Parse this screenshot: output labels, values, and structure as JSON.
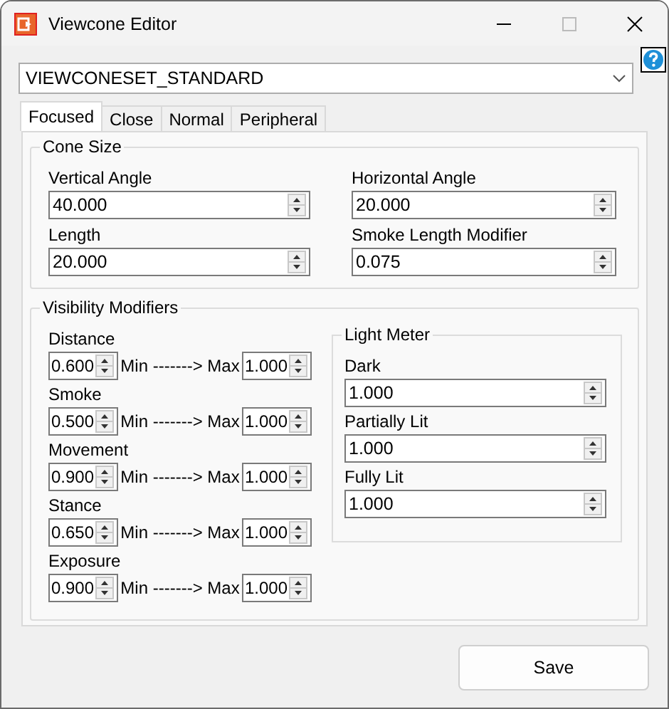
{
  "window": {
    "title": "Viewcone Editor"
  },
  "preset": {
    "value": "VIEWCONESET_STANDARD"
  },
  "tabs": [
    {
      "label": "Focused",
      "selected": true
    },
    {
      "label": "Close",
      "selected": false
    },
    {
      "label": "Normal",
      "selected": false
    },
    {
      "label": "Peripheral",
      "selected": false
    }
  ],
  "cone_size": {
    "title": "Cone Size",
    "fields": [
      {
        "label": "Vertical Angle",
        "value": "40.000"
      },
      {
        "label": "Horizontal Angle",
        "value": "20.000"
      },
      {
        "label": "Length",
        "value": "20.000"
      },
      {
        "label": "Smoke Length Modifier",
        "value": "0.075"
      }
    ]
  },
  "visibility_modifiers": {
    "title": "Visibility Modifiers",
    "rows": [
      {
        "label": "Distance",
        "min": "0.600",
        "separator": "Min -------> Max",
        "max": "1.000"
      },
      {
        "label": "Smoke",
        "min": "0.500",
        "separator": "Min -------> Max",
        "max": "1.000"
      },
      {
        "label": "Movement",
        "min": "0.900",
        "separator": "Min -------> Max",
        "max": "1.000"
      },
      {
        "label": "Stance",
        "min": "0.650",
        "separator": "Min -------> Max",
        "max": "1.000"
      },
      {
        "label": "Exposure",
        "min": "0.900",
        "separator": "Min -------> Max",
        "max": "1.000"
      }
    ],
    "light_meter": {
      "title": "Light Meter",
      "fields": [
        {
          "label": "Dark",
          "value": "1.000"
        },
        {
          "label": "Partially Lit",
          "value": "1.000"
        },
        {
          "label": "Fully Lit",
          "value": "1.000"
        }
      ]
    }
  },
  "buttons": [
    {
      "label": "Save"
    }
  ]
}
